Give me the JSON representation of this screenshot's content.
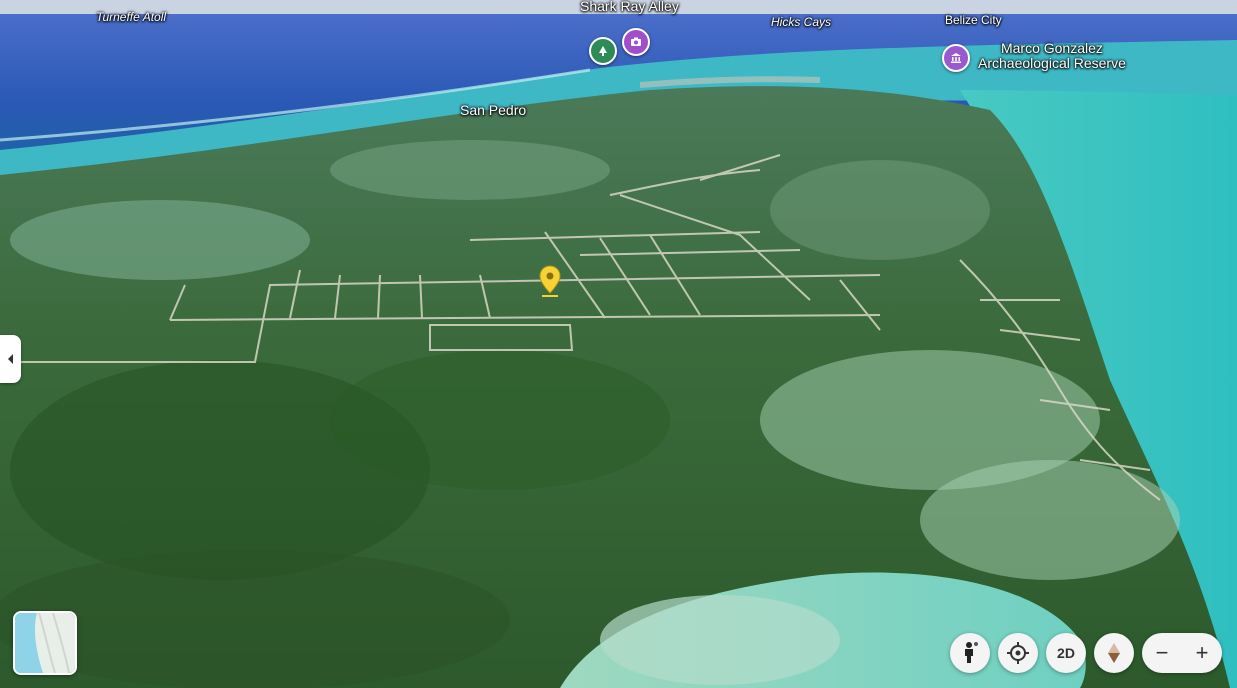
{
  "places": {
    "turneffe": "Turneffe Atoll",
    "shark_ray": "Shark Ray Alley",
    "hicks": "Hicks Cays",
    "belize_city": "Belize City",
    "marco_line1": "Marco Gonzalez",
    "marco_line2": "Archaeological Reserve",
    "san_pedro": "San Pedro"
  },
  "icons": {
    "park": "tree-icon",
    "photo": "camera-icon",
    "museum": "museum-icon",
    "pin": "map-pin-icon",
    "pegman": "pegman-icon",
    "locate": "locate-icon",
    "compass": "compass-icon"
  },
  "controls": {
    "view_toggle": "2D",
    "zoom_out": "−",
    "zoom_in": "+"
  },
  "colors": {
    "park_poi": "#2e8b57",
    "photo_poi": "#a14fc9",
    "museum_poi": "#9b59d0",
    "pin": "#f6d233"
  }
}
